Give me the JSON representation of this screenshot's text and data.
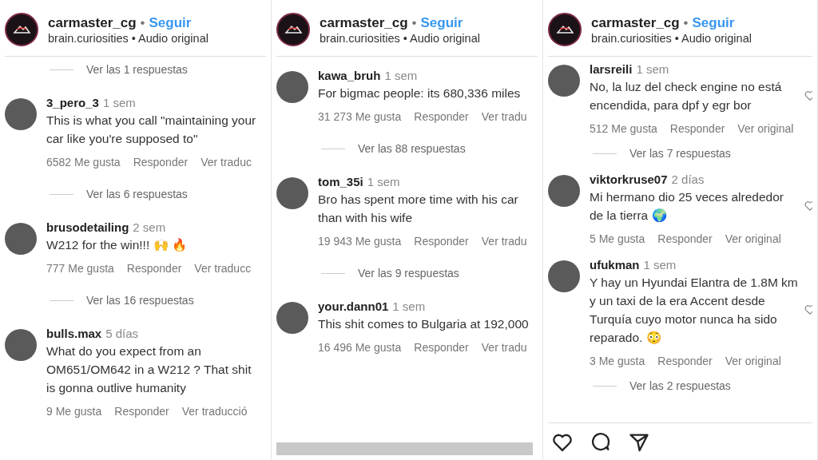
{
  "panels": [
    {
      "header": {
        "account": "carmaster_cg",
        "separator": "•",
        "follow": "Seguir",
        "audio": "brain.curiosities • Audio original"
      },
      "scrollbar": false,
      "action_bar": false,
      "like_icons": false,
      "items": [
        {
          "kind": "replies",
          "text": "Ver las 1 respuestas"
        },
        {
          "kind": "comment",
          "user": "3_pero_3",
          "time": "1 sem",
          "text": "This is what you call \"maintaining your car like you're supposed to\"",
          "likes": "6582 Me gusta",
          "reply": "Responder",
          "translate": "Ver traduc"
        },
        {
          "kind": "replies",
          "text": "Ver las 6 respuestas"
        },
        {
          "kind": "comment",
          "user": "brusodetailing",
          "time": "2 sem",
          "text": "W212 for the win!!! 🙌 🔥",
          "likes": "777 Me gusta",
          "reply": "Responder",
          "translate": "Ver traducc"
        },
        {
          "kind": "replies",
          "text": "Ver las 16 respuestas"
        },
        {
          "kind": "comment",
          "user": "bulls.max",
          "time": "5 días",
          "text": "What do you expect from an OM651/OM642 in a W212 ? That shit is gonna outlive humanity",
          "likes": "9 Me gusta",
          "reply": "Responder",
          "translate": "Ver traducció"
        }
      ]
    },
    {
      "header": {
        "account": "carmaster_cg",
        "separator": "•",
        "follow": "Seguir",
        "audio": "brain.curiosities • Audio original"
      },
      "scrollbar": true,
      "action_bar": false,
      "like_icons": false,
      "items": [
        {
          "kind": "comment",
          "user": "kawa_bruh",
          "time": "1 sem",
          "text": "For bigmac people: its 680,336 miles",
          "likes": "31 273 Me gusta",
          "reply": "Responder",
          "translate": "Ver tradu"
        },
        {
          "kind": "replies",
          "text": "Ver las 88 respuestas"
        },
        {
          "kind": "comment",
          "user": "tom_35i",
          "time": "1 sem",
          "text": "Bro has spent more time with his car than with his wife",
          "likes": "19 943 Me gusta",
          "reply": "Responder",
          "translate": "Ver tradu"
        },
        {
          "kind": "replies",
          "text": "Ver las 9 respuestas"
        },
        {
          "kind": "comment",
          "user": "your.dann01",
          "time": "1 sem",
          "text": "This shit comes to Bulgaria at 192,000",
          "likes": "16 496 Me gusta",
          "reply": "Responder",
          "translate": "Ver tradu"
        }
      ]
    },
    {
      "header": {
        "account": "carmaster_cg",
        "separator": "•",
        "follow": "Seguir",
        "audio": "brain.curiosities • Audio original"
      },
      "scrollbar": false,
      "action_bar": true,
      "like_icons": true,
      "items": [
        {
          "kind": "comment",
          "user": "larsreili",
          "time": "1 sem",
          "text": "No, la luz del check engine no está encendida, para dpf y egr bor",
          "likes": "512 Me gusta",
          "reply": "Responder",
          "translate": "Ver original"
        },
        {
          "kind": "replies",
          "text": "Ver las 7 respuestas"
        },
        {
          "kind": "comment",
          "user": "viktorkruse07",
          "time": "2 días",
          "text": "Mi hermano dio 25 veces alrededor de la tierra 🌍",
          "likes": "5 Me gusta",
          "reply": "Responder",
          "translate": "Ver original"
        },
        {
          "kind": "comment",
          "user": "ufukman",
          "time": "1 sem",
          "text": "Y hay un Hyundai Elantra de 1.8M km y un taxi de la era Accent desde Turquía cuyo motor nunca ha sido reparado. 😳",
          "likes": "3 Me gusta",
          "reply": "Responder",
          "translate": "Ver original"
        },
        {
          "kind": "replies",
          "text": "Ver las 2 respuestas"
        }
      ]
    }
  ]
}
